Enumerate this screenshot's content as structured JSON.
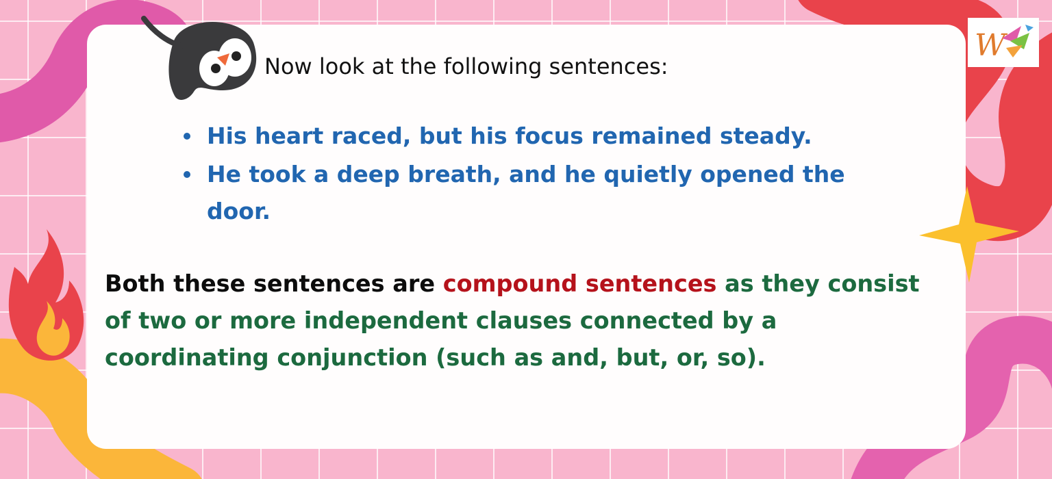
{
  "slide": {
    "intro": "Now look at the following sentences:",
    "examples": [
      "His heart raced, but his focus remained steady.",
      "He took a deep breath, and he quietly opened the door."
    ],
    "summary": {
      "lead": "Both these sentences are ",
      "term": "compound sentences",
      "rest": " as they consist of two or more independent clauses connected by a coordinating conjunction (such as and, but, or, so)."
    }
  },
  "icons": {
    "mascot": "penguin-icon",
    "flame": "fire-icon",
    "sparkle": "star-burst-icon",
    "logo": "w-logo-icon"
  },
  "colors": {
    "background": "#f9b5cd",
    "card": "#fffdfd",
    "example_text": "#2166b0",
    "highlight_term": "#b5121b",
    "explanation_text": "#1c6a3f"
  }
}
